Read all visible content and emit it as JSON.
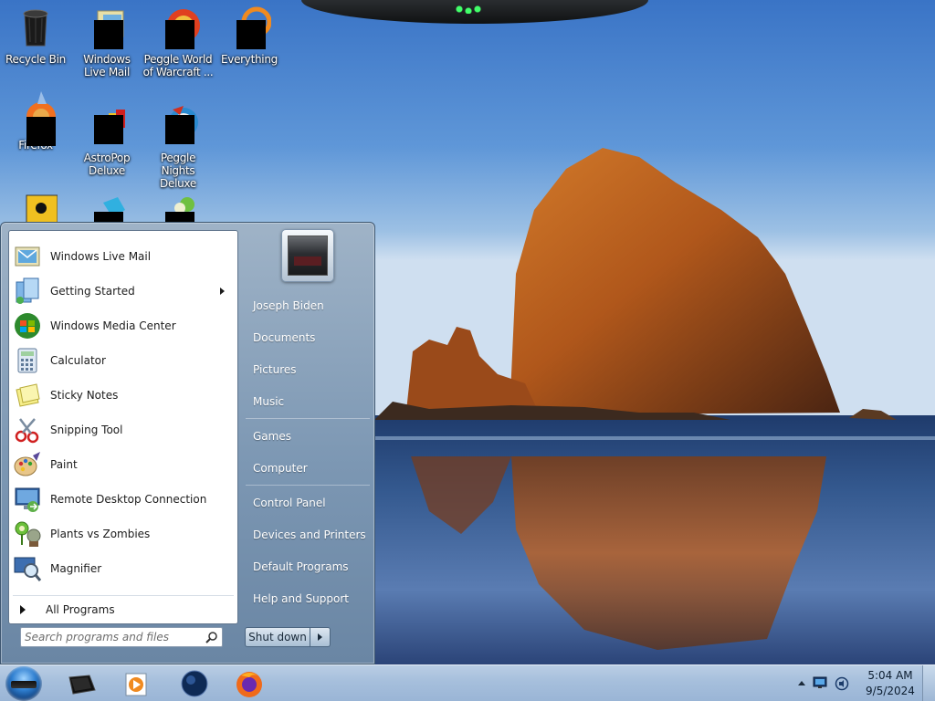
{
  "desktop": {
    "icons": [
      {
        "label": "Recycle Bin",
        "icon": "recycle-bin-icon"
      },
      {
        "label": "Windows Live Mail",
        "icon": "windows-live-mail-icon"
      },
      {
        "label": "Peggle World of Warcraft ...",
        "icon": "peggle-wow-icon"
      },
      {
        "label": "Everything",
        "icon": "everything-icon"
      },
      {
        "label": "Firefox",
        "icon": "firefox-icon"
      },
      {
        "label": "AstroPop Deluxe",
        "icon": "astropop-icon"
      },
      {
        "label": "Peggle Nights Deluxe",
        "icon": "peggle-nights-icon"
      }
    ]
  },
  "start_menu": {
    "programs": [
      {
        "label": "Windows Live Mail",
        "icon": "mail-icon"
      },
      {
        "label": "Getting Started",
        "icon": "getting-started-icon",
        "has_submenu": true
      },
      {
        "label": "Windows Media Center",
        "icon": "media-center-icon"
      },
      {
        "label": "Calculator",
        "icon": "calculator-icon"
      },
      {
        "label": "Sticky Notes",
        "icon": "sticky-notes-icon"
      },
      {
        "label": "Snipping Tool",
        "icon": "snipping-tool-icon"
      },
      {
        "label": "Paint",
        "icon": "paint-icon"
      },
      {
        "label": "Remote Desktop Connection",
        "icon": "remote-desktop-icon"
      },
      {
        "label": "Plants vs Zombies",
        "icon": "plants-vs-zombies-icon"
      },
      {
        "label": "Magnifier",
        "icon": "magnifier-icon"
      }
    ],
    "all_programs_label": "All Programs",
    "search_placeholder": "Search programs and files",
    "right_items": [
      {
        "label": "Joseph Biden"
      },
      {
        "label": "Documents"
      },
      {
        "label": "Pictures"
      },
      {
        "label": "Music"
      },
      {
        "label": "Games"
      },
      {
        "label": "Computer"
      },
      {
        "label": "Control Panel"
      },
      {
        "label": "Devices and Printers"
      },
      {
        "label": "Default Programs"
      },
      {
        "label": "Help and Support"
      }
    ],
    "shutdown_label": "Shut down"
  },
  "taskbar": {
    "pinned": [
      {
        "icon": "explorer-icon"
      },
      {
        "icon": "media-player-icon"
      },
      {
        "icon": "media-center-taskbar-icon"
      },
      {
        "icon": "firefox-taskbar-icon"
      }
    ],
    "clock": {
      "time": "5:04 AM",
      "date": "9/5/2024"
    }
  }
}
